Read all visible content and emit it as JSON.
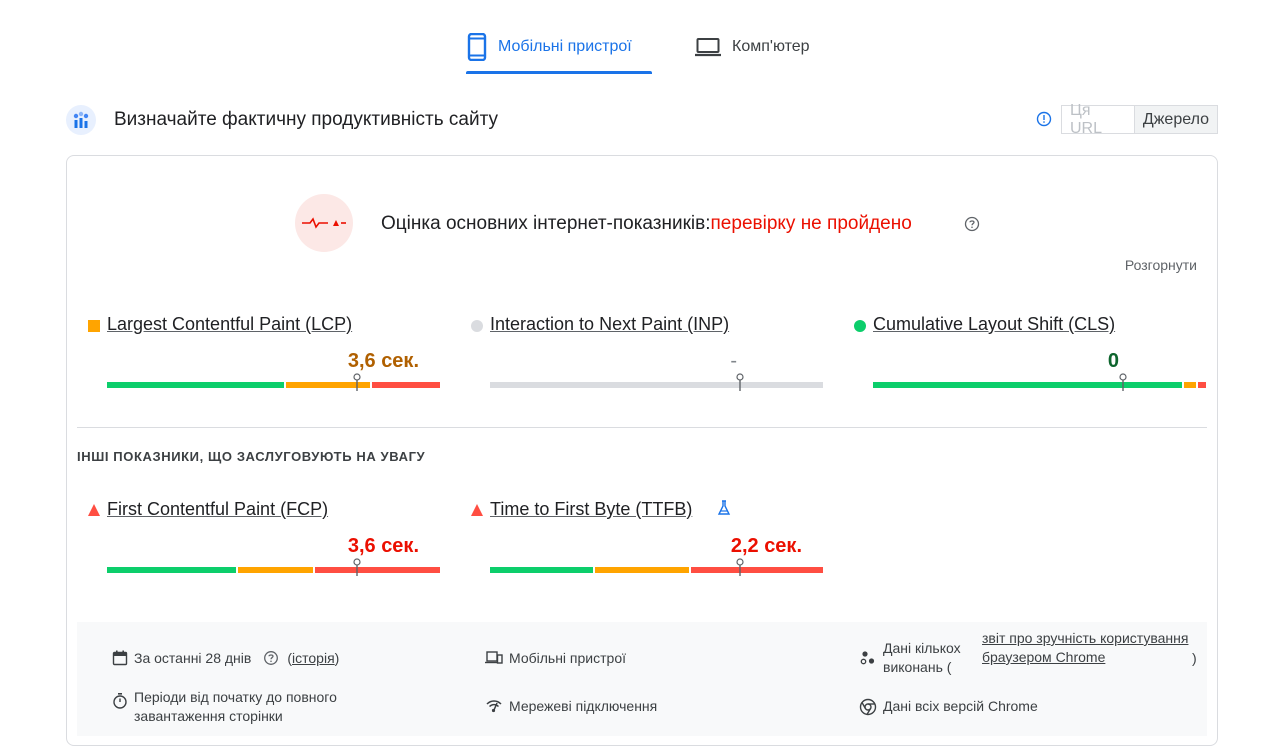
{
  "tabs": {
    "mobile": {
      "label": "Мобільні пристрої",
      "icon": "smartphone-icon"
    },
    "desktop": {
      "label": "Комп'ютер",
      "icon": "laptop-icon"
    }
  },
  "header": {
    "title": "Визначайте фактичну продуктивність сайту",
    "toggle_url": "Ця URL",
    "toggle_origin": "Джерело"
  },
  "assessment": {
    "label": "Оцінка основних інтернет-показників:",
    "status": "перевірку не пройдено",
    "expand": "Розгорнути"
  },
  "core_metrics": [
    {
      "name": "Largest Contentful Paint (LCP)",
      "value": "3,6 сек.",
      "status": "needs-improvement",
      "color": "#b06000",
      "indicator_color": "#ffa400",
      "marker_fraction": 0.75
    },
    {
      "name": "Interaction to Next Paint (INP)",
      "value": "-",
      "status": "no-data",
      "color": "#80868b",
      "indicator_color": "#dadce0",
      "marker_fraction": 0.75
    },
    {
      "name": "Cumulative Layout Shift (CLS)",
      "value": "0",
      "status": "good",
      "color": "#0d652d",
      "indicator_color": "#0cce6b",
      "marker_fraction": 0.75
    }
  ],
  "other_heading": "ІНШІ ПОКАЗНИКИ, ЩО ЗАСЛУГОВУЮТЬ НА УВАГУ",
  "other_metrics": [
    {
      "name": "First Contentful Paint (FCP)",
      "value": "3,6 сек.",
      "status": "poor",
      "color": "#eb0f00",
      "indicator_color": "#ff4e42",
      "marker_fraction": 0.75
    },
    {
      "name": "Time to First Byte (TTFB)",
      "value": "2,2 сек.",
      "status": "poor",
      "color": "#eb0f00",
      "indicator_color": "#ff4e42",
      "marker_fraction": 0.75,
      "experimental_icon": "flask-icon"
    }
  ],
  "footer": {
    "period": "За останні 28 днів",
    "history_open": "(",
    "history_link": "історія",
    "history_close": ")",
    "device": "Мобільні пристрої",
    "sources_prefix": "Дані кількох виконань (",
    "sources_link": "звіт про зручність користування браузером Chrome",
    "sources_suffix": ")",
    "durations": "Періоди від початку до повного завантаження сторінки",
    "network": "Мережеві підключення",
    "chrome_versions": "Дані всіх версій Chrome"
  },
  "colors": {
    "good": "#0cce6b",
    "average": "#ffa400",
    "poor": "#ff4e42",
    "accent": "#1a73e8",
    "no_data": "#dadce0"
  }
}
